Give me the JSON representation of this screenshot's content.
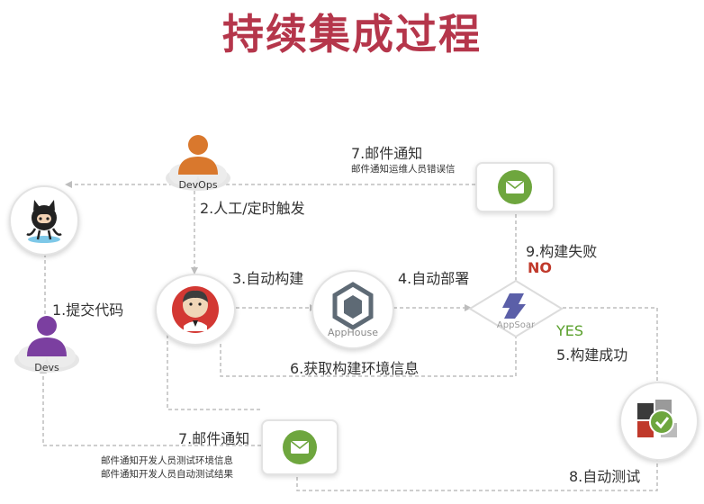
{
  "title": "持续集成过程",
  "colors": {
    "title": "#b5364b",
    "no": "#c0392b",
    "yes": "#5aa02c",
    "mail": "#6ea63e",
    "person_orange": "#d9782d",
    "person_purple": "#7b3fa0"
  },
  "nodes": {
    "devops": "DevOps",
    "devs": "Devs",
    "apphouse": "AppHouse",
    "appsoar": "AppSoar"
  },
  "steps": {
    "s1": "1.提交代码",
    "s2": "2.人工/定时触发",
    "s3": "3.自动构建",
    "s4": "4.自动部署",
    "s5": "5.构建成功",
    "s6": "6.获取构建环境信息",
    "s7_top": "7.邮件通知",
    "s7_top_sub": "邮件通知运维人员错误信",
    "s7_bottom": "7.邮件通知",
    "s7_bottom_sub1": "邮件通知开发人员测试环境信息",
    "s7_bottom_sub2": "邮件通知开发人员自动测试结果",
    "s8": "8.自动测试",
    "s9": "9.构建失败",
    "no": "NO",
    "yes": "YES"
  },
  "icons": {
    "github": "github-octocat-icon",
    "jenkins": "jenkins-butler-icon",
    "apphouse": "apphouse-logo-icon",
    "appsoar": "appsoar-logo-icon",
    "mail": "mail-envelope-icon",
    "test": "puzzle-checkmark-icon"
  }
}
